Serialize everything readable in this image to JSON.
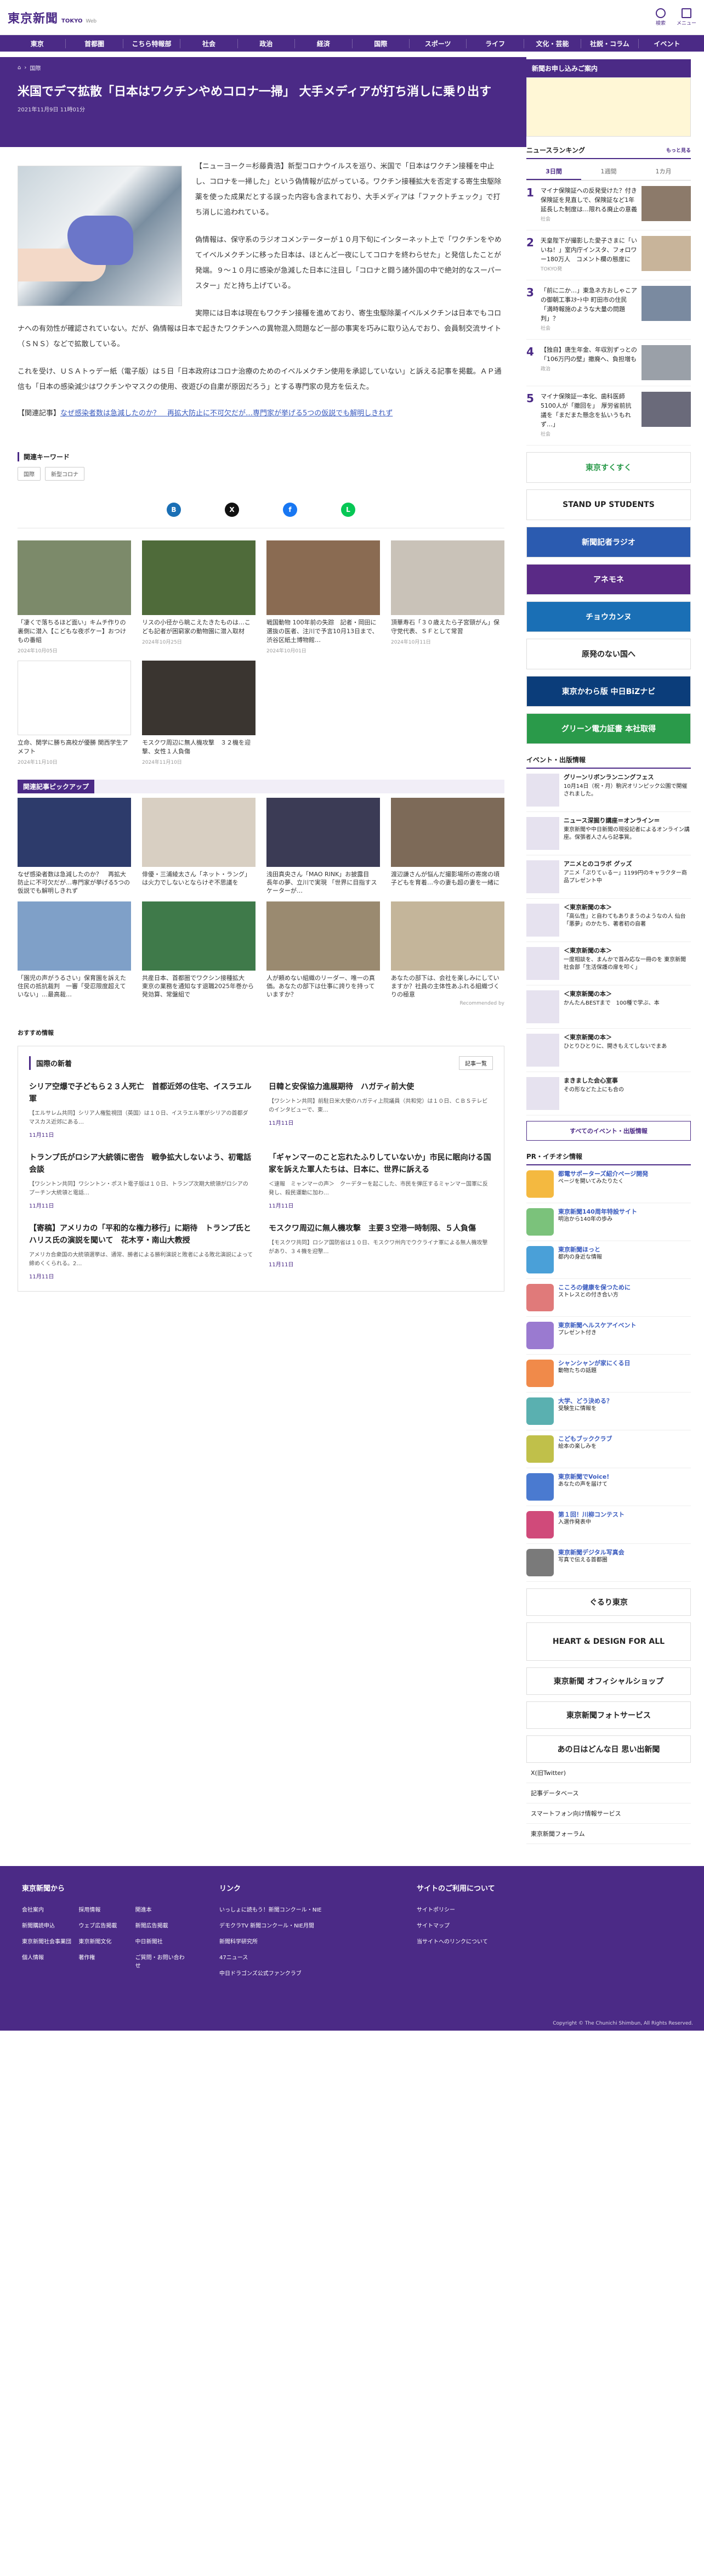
{
  "header": {
    "logo_jp": "東京新聞",
    "logo_en": "TOKYO",
    "logo_web": "Web",
    "search": "検索",
    "menu": "メニュー"
  },
  "nav": [
    "東京",
    "首都圏",
    "こちら特報部",
    "社会",
    "政治",
    "経済",
    "国際",
    "スポーツ",
    "ライフ",
    "文化・芸能",
    "社説・コラム",
    "イベント"
  ],
  "breadcrumb": [
    "国際"
  ],
  "article": {
    "title": "米国でデマ拡散「日本はワクチンやめコロナ一掃」 大手メディアが打ち消しに乗り出す",
    "date": "2021年11月9日 11時01分",
    "p1": "【ニューヨーク＝杉藤貴浩】新型コロナウイルスを巡り、米国で「日本はワクチン接種を中止し、コロナを一掃した」という偽情報が広がっている。ワクチン接種拡大を否定する寄生虫駆除薬を使った成果だとする誤った内容も含まれており、大手メディアは「ファクトチェック」で打ち消しに追われている。",
    "p2": "偽情報は、保守系のラジオコメンテーターが１０月下旬にインターネット上で「ワクチンをやめてイベルメクチンに移った日本は、ほとんど一夜にしてコロナを終わらせた」と発信したことが発端。９～１０月に感染が急減した日本に注目し「コロナと闘う諸外国の中で絶対的なスーパースター」だと持ち上げている。",
    "p3": "実際には日本は現在もワクチン接種を進めており、寄生虫駆除薬イベルメクチンは日本でもコロナへの有効性が確認されていない。だが、偽情報は日本で起きたワクチンへの異物混入問題など一部の事実を巧みに取り込んでおり、会員制交流サイト（ＳＮＳ）などで拡散している。",
    "p4": "これを受け、ＵＳＡトゥデー紙（電子版）は５日「日本政府はコロナ治療のためのイベルメクチン使用を承認していない」と訴える記事を掲載。ＡＰ通信も「日本の感染減少はワクチンやマスクの使用、夜遊びの自粛が原因だろう」とする専門家の見方を伝えた。",
    "related_label": "【関連記事】",
    "related_link": "なぜ感染者数は急減したのか？　再拡大防止に不可欠だが…専門家が挙げる5つの仮説でも解明しきれず"
  },
  "keywords": {
    "heading": "関連キーワード",
    "items": [
      "国際",
      "新型コロナ"
    ]
  },
  "related": [
    {
      "cap": "「凄くで落ちるほど面い」キムチ作りの裏側に潜入【こどもな夜ポケー】おつけもの番組",
      "date": "2024年10月05日"
    },
    {
      "cap": "リスの小径から眺こえたきたものは…こども記者が困窮家の動物園に潜入取材",
      "date": "2024年10月25日"
    },
    {
      "cap": "戦国動物 100年前の失踪　記者・岡田に選抜の医者、注川で予言10月13日まで、渋谷区紙土博物館…",
      "date": "2024年10月01日"
    },
    {
      "cap": "頂華寿石「３０歳えたら子宮頸がん」保守党代表、ＳＦとして常習",
      "date": "2024年10月11日"
    },
    {
      "cap": "立命、関学に勝ち高校が優勝 関西学生アメフト",
      "date": "2024年11月10日"
    },
    {
      "cap": "モスクワ周辺に無人機攻撃　３２機を迎撃、女性１人負傷",
      "date": "2024年11月10日"
    }
  ],
  "pickup": {
    "heading": "関連記事ピックアップ",
    "items": [
      {
        "cap": "なぜ感染者数は急減したのか？　再拡大防止に不可欠だが…専門家が挙げる5つの仮説でも解明しきれず"
      },
      {
        "cap": "俳優・三浦綾太さん「ネット・ラング」は火力でしないとならけぞ不思議を"
      },
      {
        "cap": "浅田真央さん「MAO RINK」お披露目　長年の夢、立川で実現 「世界に目指すスケーターが…"
      },
      {
        "cap": "渡辺謙さんが悩んだ撮影場所の寄席の頃　子どもを育着…今の妻も超の妻を一緒に"
      },
      {
        "cap": "「園児の声がうるさい」保育園を訴えた住民の抵抗裁判　一審「受忍限度超えていない」…最高裁…"
      },
      {
        "cap": "共産日本、首都圏でワクシン接種拡大　東京の業務を通知なす退職2025年巻から発効算、常盤組で"
      },
      {
        "cap": "人が頼めない組織のリーダー、唯一の真価。あなたの部下は仕事に誇りを持っていますか？"
      },
      {
        "cap": "あなたの部下は、会社を楽しみにしていますか？社員の主体性あふれる組織づくりの極意"
      }
    ],
    "recommended": "Recommended by"
  },
  "osusume": "おすすめ情報",
  "intl": {
    "heading": "国際の新着",
    "more": "記事一覧",
    "items": [
      {
        "t": "シリア空爆で子どもら２３人死亡　首都近郊の住宅、イスラエル軍",
        "p": "【エルサレム共同】シリア人権監視団（英国）は１０日、イスラエル軍がシリアの首都ダマスカス近郊にある…",
        "d": "11月11日"
      },
      {
        "t": "日韓と安保協力進展期待　ハガティ前大使",
        "p": "【ワシントン共同】前駐日米大使のハガティ上院議員（共和党）は１０日、ＣＢＳテレビのインタビューで、東…",
        "d": "11月11日"
      },
      {
        "t": "トランプ氏がロシア大統領に密告　戦争拡大しないよう、初電話会談",
        "p": "【ワシントン共同】ワシントン・ポスト電子版は１０日、トランプ次期大統領がロシアのプーチン大統領と電話…",
        "d": "11月11日"
      },
      {
        "t": "「ギャンマーのこと忘れたふりしていないか」市民に眠向ける国家を訴えた軍人たちは、日本に、世界に訴える",
        "p": "＜速報　ミャンマーの声＞　クーデターを起こした、市民を弾圧するミャンマー国軍に反発し、殺民運動に加わ…",
        "d": "11月11日"
      },
      {
        "t": "【寄稿】アメリカの「平和的な権力移行」に期待　トランプ氏とハリス氏の演説を聞いて　花木亨・南山大教授",
        "p": "アメリカ合衆国の大統領選挙は、通常、勝者による勝利演説と敗者による敗北演説によって締めくくられる。2…",
        "d": "11月11日"
      },
      {
        "t": "モスクワ周辺に無人機攻撃　主要３空港一時制限、５人負傷",
        "p": "【モスクワ共同】ロシア国防省は１０日、モスクワ州内でウクライナ軍による無人機攻撃があり、３４機を迎撃…",
        "d": "11月11日"
      }
    ]
  },
  "side": {
    "promo": "新聞お申し込みご案内",
    "ranking": {
      "heading": "ニュースランキング",
      "more": "もっと見る",
      "tabs": [
        "3日間",
        "1週間",
        "1カ月"
      ],
      "items": [
        {
          "no": "1",
          "t": "マイナ保険証への反発受けた？付き保険証を見直しで、保険証など1年延長した制度は…限れる廃止の意義",
          "c": "社会"
        },
        {
          "no": "2",
          "t": "天皇陛下が撮影した愛子さまに「いいね！」室内庁インスタ、フォロワー180万人　コメント欄の態度に",
          "c": "TOKYO発"
        },
        {
          "no": "3",
          "t": "「前に二か…」東急ネ方おしゃこアの御朝工事ｽﾀｰﾄ中 町田市の住民「満時報施のような大量の問題判」？",
          "c": "社会"
        },
        {
          "no": "4",
          "t": "【独自】唐生年金、年収別ずっとの「106万円の壁」撤廃へ、負担増も",
          "c": "政治"
        },
        {
          "no": "5",
          "t": "マイナ保険証一本化、歯科医師5100人が「撤回を」　厚労省前抗議を「まだまた懸念を払いうもれず…」",
          "c": "社会"
        }
      ]
    },
    "banners": [
      "東京すくすく",
      "STAND UP STUDENTS",
      "新聞記者ラジオ",
      "アネモネ",
      "チョウカンヌ",
      "原発のない国へ",
      "東京かわら版 中日BiZナビ",
      "グリーン電力証書 本社取得"
    ],
    "events_h": "イベント・出版情報",
    "events": [
      {
        "b": "グリーンリボンランニングフェス",
        "t": "10月14日（祝・月）駒沢オリンピック公園で開催されました。"
      },
      {
        "b": "ニュース深掘り講座＝オンライン＝",
        "t": "東京新聞や中日新聞の現役記者によるオンライン講座。保張者人さんら記事質。"
      },
      {
        "b": "アニメとのコラボ グッズ",
        "t": "アニメ「ぷりてぃるー」1199円のキャラクター商品プレゼント中"
      },
      {
        "b": "＜東京新聞の本＞",
        "t": "「高仏性」と自わてもありまうのようなの人 仙台「悪夢」のかたち、著者初の自著"
      },
      {
        "b": "＜東京新聞の本＞",
        "t": "一度相談を、まんかで首み応な一冊のを 東京新聞社会部「生活保護の扉を叩く」"
      },
      {
        "b": "＜東京新聞の本＞",
        "t": "かんたんBESTまで　100種で学ぶ、本"
      },
      {
        "b": "＜東京新聞の本＞",
        "t": "ひとりひとりに、開きもえてしないでまあ"
      },
      {
        "b": "まきました会心室事",
        "t": "その形などた上にも合の"
      }
    ],
    "sbtn": "すべてのイベント・出版情報",
    "pr_h": "PR・イチオシ情報",
    "prs": [
      {
        "b": "都電サポーターズ紹介ページ開発",
        "t": "ページを開いてみたりたく"
      },
      {
        "b": "東京新聞140周年特設サイト",
        "t": "明治から140年の歩み"
      },
      {
        "b": "東京新聞ほっと",
        "t": "都内の身近な情報"
      },
      {
        "b": "こころの健康を保つために",
        "t": "ストレスとの付き合い方"
      },
      {
        "b": "東京新聞ヘルスケアイベント",
        "t": "プレゼント付き"
      },
      {
        "b": "シャンシャンが家にくる日",
        "t": "動物たちの話題"
      },
      {
        "b": "大学、どう決める？",
        "t": "受験生に情報を"
      },
      {
        "b": "こどもブッククラブ",
        "t": "絵本の楽しみを"
      },
      {
        "b": "東京新聞でVoice!",
        "t": "あなたの声を届けて"
      },
      {
        "b": "第１回！川柳コンテスト",
        "t": "入選作発表中"
      },
      {
        "b": "東京新聞デジタル写真会",
        "t": "写真で伝える首都圏"
      }
    ],
    "bottom": [
      "ぐるり東京",
      "HEART & DESIGN FOR ALL",
      "東京新聞 オフィシャルショップ",
      "東京新聞フォトサービス",
      "あの日はどんな日 思い出新聞"
    ],
    "blist": [
      "X(旧Twitter)",
      "記事データベース",
      "スマートフォン向け情報サービス",
      "東京新聞フォーラム"
    ]
  },
  "footer": {
    "c1": {
      "h": "東京新聞から",
      "links": [
        "会社案内",
        "採用情報",
        "開進本",
        "新聞購読申込",
        "ウェブ広告掲載",
        "新聞広告掲載",
        "東京新聞社会事業団",
        "東京新聞文化",
        "中日新聞社",
        "個人情報",
        "著作権",
        "ご質問・お問い合わせ"
      ]
    },
    "c2": {
      "h": "リンク",
      "links": [
        "いっしょに読もう！新聞コンクール・NIE",
        "デモクラTV 新聞コンクール・NIE月間",
        "新聞科学研究所",
        "47ニュース",
        "中日ドラゴンズ公式ファンクラブ"
      ]
    },
    "c3": {
      "h": "サイトのご利用について",
      "links": [
        "サイトポリシー",
        "サイトマップ",
        "当サイトへのリンクについて"
      ]
    },
    "copy": "Copyright © The Chunichi Shimbun, All Rights Reserved."
  }
}
